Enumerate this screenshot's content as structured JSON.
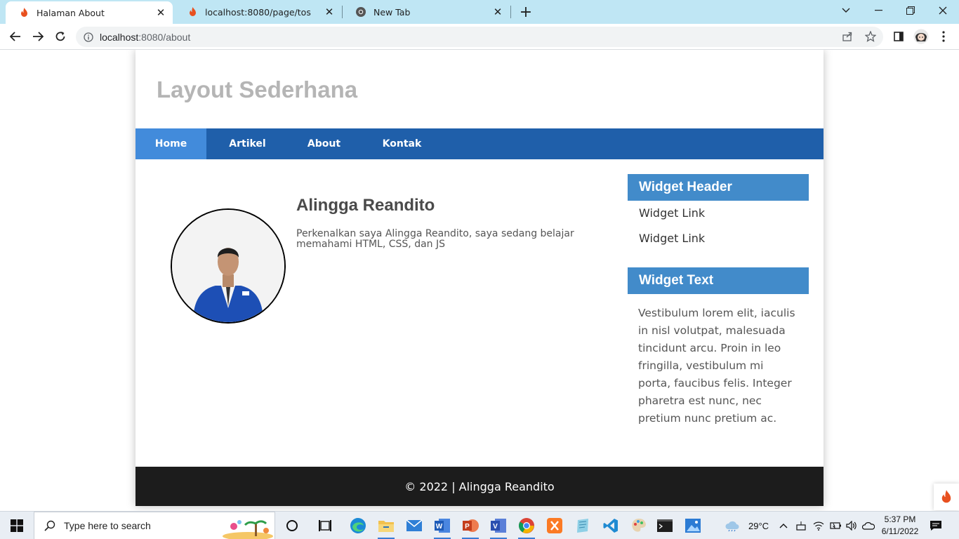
{
  "browser": {
    "tabs": [
      {
        "title": "Halaman About",
        "icon": "flame-icon",
        "active": true
      },
      {
        "title": "localhost:8080/page/tos",
        "icon": "flame-icon",
        "active": false
      },
      {
        "title": "New Tab",
        "icon": "chrome-icon",
        "active": false
      }
    ],
    "url_host": "localhost",
    "url_path": ":8080/about"
  },
  "site": {
    "title": "Layout Sederhana",
    "nav": [
      "Home",
      "Artikel",
      "About",
      "Kontak"
    ],
    "active_nav": "Home",
    "profile": {
      "name": "Alingga Reandito",
      "description": "Perkenalkan saya Alingga Reandito, saya sedang belajar memahami HTML, CSS, dan JS"
    },
    "widgets": {
      "header_title": "Widget Header",
      "links": [
        "Widget Link",
        "Widget Link"
      ],
      "text_title": "Widget Text",
      "text_body": "Vestibulum lorem elit, iaculis in nisl volutpat, malesuada tincidunt arcu. Proin in leo fringilla, vestibulum mi porta, faucibus felis. Integer pharetra est nunc, nec pretium nunc pretium ac."
    },
    "footer": "© 2022 | Alingga Reandito"
  },
  "taskbar": {
    "search_placeholder": "Type here to search",
    "weather": "29°C",
    "time": "5:37 PM",
    "date": "6/11/2022"
  },
  "colors": {
    "nav_bg": "#1f5faa",
    "nav_active": "#428bdb",
    "widget_header": "#428bca",
    "footer_bg": "#1c1c1c",
    "tabstrip": "#bfe6f4"
  }
}
